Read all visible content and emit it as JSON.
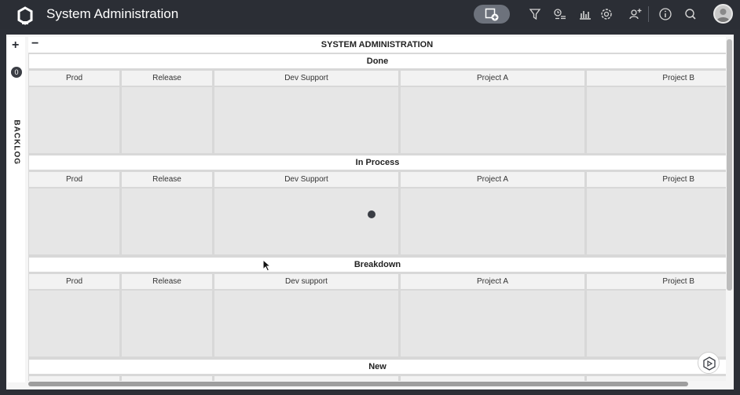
{
  "app": {
    "title": "System Administration"
  },
  "toolbar": {
    "icons": [
      "add-view-icon",
      "filter-icon",
      "card-legend-icon",
      "chart-icon",
      "gear-icon",
      "add-user-icon",
      "info-icon",
      "search-icon"
    ]
  },
  "backlog": {
    "label": "BACKLOG",
    "count": "0"
  },
  "board": {
    "title": "SYSTEM ADMINISTRATION",
    "lanes": [
      {
        "name": "Done",
        "columns": [
          "Prod",
          "Release",
          "Dev Support",
          "Project A",
          "Project B"
        ]
      },
      {
        "name": "In Process",
        "columns": [
          "Prod",
          "Release",
          "Dev Support",
          "Project A",
          "Project B"
        ]
      },
      {
        "name": "Breakdown",
        "columns": [
          "Prod",
          "Release",
          "Dev support",
          "Project A",
          "Project B"
        ]
      },
      {
        "name": "New",
        "columns": []
      }
    ]
  },
  "colors": {
    "topbar": "#2b2e35",
    "cell": "#e6e6e6",
    "header": "#ffffff"
  }
}
